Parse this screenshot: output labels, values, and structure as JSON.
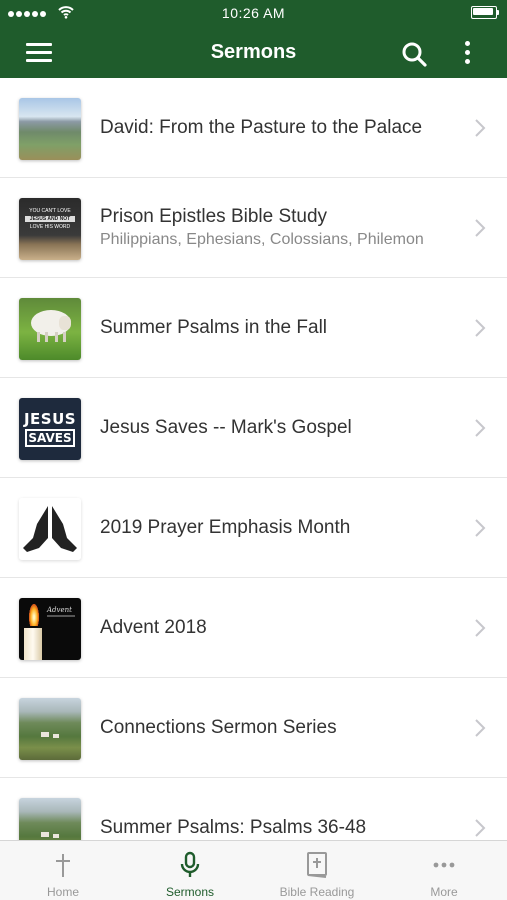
{
  "status_bar": {
    "time": "10:26 AM"
  },
  "nav": {
    "title": "Sermons"
  },
  "sermons": [
    {
      "title": "David: From the Pasture to the Palace",
      "subtitle": "",
      "thumbnail": "mountain-landscape"
    },
    {
      "title": "Prison Epistles Bible Study",
      "subtitle": "Philippians, Ephesians, Colossians, Philemon",
      "thumbnail": "open-bible-book"
    },
    {
      "title": "Summer Psalms in the Fall",
      "subtitle": "",
      "thumbnail": "sheep-in-field"
    },
    {
      "title": "Jesus Saves -- Mark's Gospel",
      "subtitle": "",
      "thumbnail": "jesus-saves-logo"
    },
    {
      "title": "2019 Prayer Emphasis Month",
      "subtitle": "",
      "thumbnail": "praying-hands"
    },
    {
      "title": "Advent 2018",
      "subtitle": "",
      "thumbnail": "advent-candle"
    },
    {
      "title": "Connections Sermon Series",
      "subtitle": "",
      "thumbnail": "green-valley"
    },
    {
      "title": "Summer Psalms: Psalms 36-48",
      "subtitle": "",
      "thumbnail": "green-valley"
    }
  ],
  "thumbnail_text": {
    "book_line1": "YOU CAN'T LOVE",
    "book_line2": "JESUS AND NOT",
    "book_line3": "LOVE HIS WORD",
    "jesus_line1": "JESUS",
    "jesus_line2": "SAVES",
    "advent_word": "Advent"
  },
  "tabs": [
    {
      "label": "Home",
      "icon": "cross-icon",
      "active": false
    },
    {
      "label": "Sermons",
      "icon": "microphone-icon",
      "active": true
    },
    {
      "label": "Bible Reading",
      "icon": "bible-icon",
      "active": false
    },
    {
      "label": "More",
      "icon": "ellipsis-icon",
      "active": false
    }
  ],
  "colors": {
    "header_bg": "#1f5c2c",
    "active_tab": "#1f5c2c",
    "inactive_tab": "#999999",
    "title_text": "#333333",
    "subtitle_text": "#888888"
  }
}
